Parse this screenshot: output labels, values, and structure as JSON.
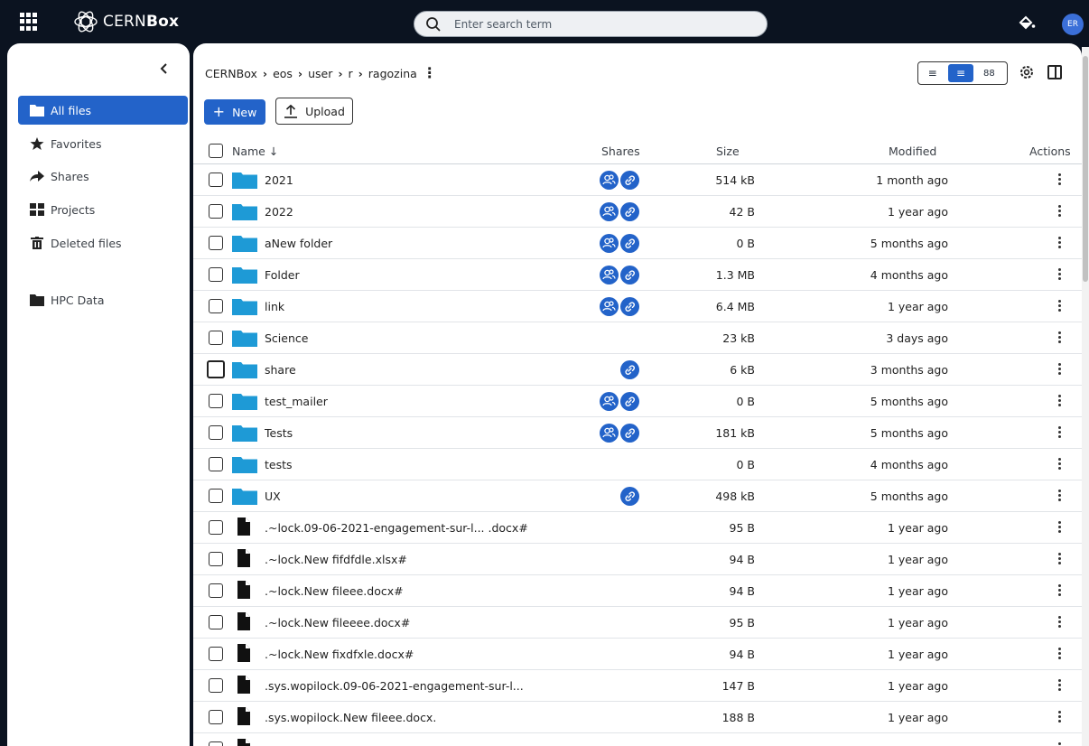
{
  "app": {
    "brand_light": "CERN",
    "brand_bold": "Box",
    "user_initials": "ER"
  },
  "search": {
    "placeholder": "Enter search term"
  },
  "sidebar": {
    "items": [
      {
        "label": "All files",
        "icon": "folder-icon",
        "active": true
      },
      {
        "label": "Favorites",
        "icon": "star-icon"
      },
      {
        "label": "Shares",
        "icon": "share-arrow-icon"
      },
      {
        "label": "Projects",
        "icon": "grid-icon"
      },
      {
        "label": "Deleted files",
        "icon": "trash-icon"
      },
      {
        "label": "HPC Data",
        "icon": "folder-icon"
      }
    ]
  },
  "breadcrumb": [
    "CERNBox",
    "eos",
    "user",
    "r",
    "ragozina"
  ],
  "toolbar": {
    "new_label": "New",
    "upload_label": "Upload"
  },
  "table": {
    "headers": {
      "name": "Name ↓",
      "shares": "Shares",
      "size": "Size",
      "modified": "Modified",
      "actions": "Actions"
    },
    "rows": [
      {
        "type": "folder",
        "name": "2021",
        "shares": [
          "people",
          "link"
        ],
        "size": "514 kB",
        "modified": "1 month ago"
      },
      {
        "type": "folder",
        "name": "2022",
        "shares": [
          "people",
          "link"
        ],
        "size": "42 B",
        "modified": "1 year ago"
      },
      {
        "type": "folder",
        "name": "aNew folder",
        "shares": [
          "people",
          "link"
        ],
        "size": "0 B",
        "modified": "5 months ago"
      },
      {
        "type": "folder",
        "name": "Folder",
        "shares": [
          "people",
          "link"
        ],
        "size": "1.3 MB",
        "modified": "4 months ago"
      },
      {
        "type": "folder",
        "name": "link",
        "shares": [
          "people",
          "link"
        ],
        "size": "6.4 MB",
        "modified": "1 year ago"
      },
      {
        "type": "folder",
        "name": "Science",
        "shares": [],
        "size": "23 kB",
        "modified": "3 days ago"
      },
      {
        "type": "folder",
        "name": "share",
        "shares": [
          "link"
        ],
        "size": "6 kB",
        "modified": "3 months ago",
        "hover": true
      },
      {
        "type": "folder",
        "name": "test_mailer",
        "shares": [
          "people",
          "link"
        ],
        "size": "0 B",
        "modified": "5 months ago"
      },
      {
        "type": "folder",
        "name": "Tests",
        "shares": [
          "people",
          "link"
        ],
        "size": "181 kB",
        "modified": "5 months ago"
      },
      {
        "type": "folder",
        "name": "tests",
        "shares": [],
        "size": "0 B",
        "modified": "4 months ago"
      },
      {
        "type": "folder",
        "name": "UX",
        "shares": [
          "link"
        ],
        "size": "498 kB",
        "modified": "5 months ago"
      },
      {
        "type": "file",
        "name": ".~lock.09-06-2021-engagement-sur-l... .docx#",
        "shares": [],
        "size": "95 B",
        "modified": "1 year ago"
      },
      {
        "type": "file",
        "name": ".~lock.New fifdfdle.xlsx#",
        "shares": [],
        "size": "94 B",
        "modified": "1 year ago"
      },
      {
        "type": "file",
        "name": ".~lock.New fileee.docx#",
        "shares": [],
        "size": "94 B",
        "modified": "1 year ago"
      },
      {
        "type": "file",
        "name": ".~lock.New fileeee.docx#",
        "shares": [],
        "size": "95 B",
        "modified": "1 year ago"
      },
      {
        "type": "file",
        "name": ".~lock.New fixdfxle.docx#",
        "shares": [],
        "size": "94 B",
        "modified": "1 year ago"
      },
      {
        "type": "file",
        "name": ".sys.wopilock.09-06-2021-engagement-sur-l...",
        "shares": [],
        "size": "147 B",
        "modified": "1 year ago"
      },
      {
        "type": "file",
        "name": ".sys.wopilock.New fileee.docx.",
        "shares": [],
        "size": "188 B",
        "modified": "1 year ago"
      },
      {
        "type": "file",
        "name": "",
        "shares": [],
        "size": "",
        "modified": ""
      }
    ]
  },
  "colors": {
    "accent": "#2363c9",
    "folder": "#1e9ad6",
    "topbar": "#0b1320"
  }
}
